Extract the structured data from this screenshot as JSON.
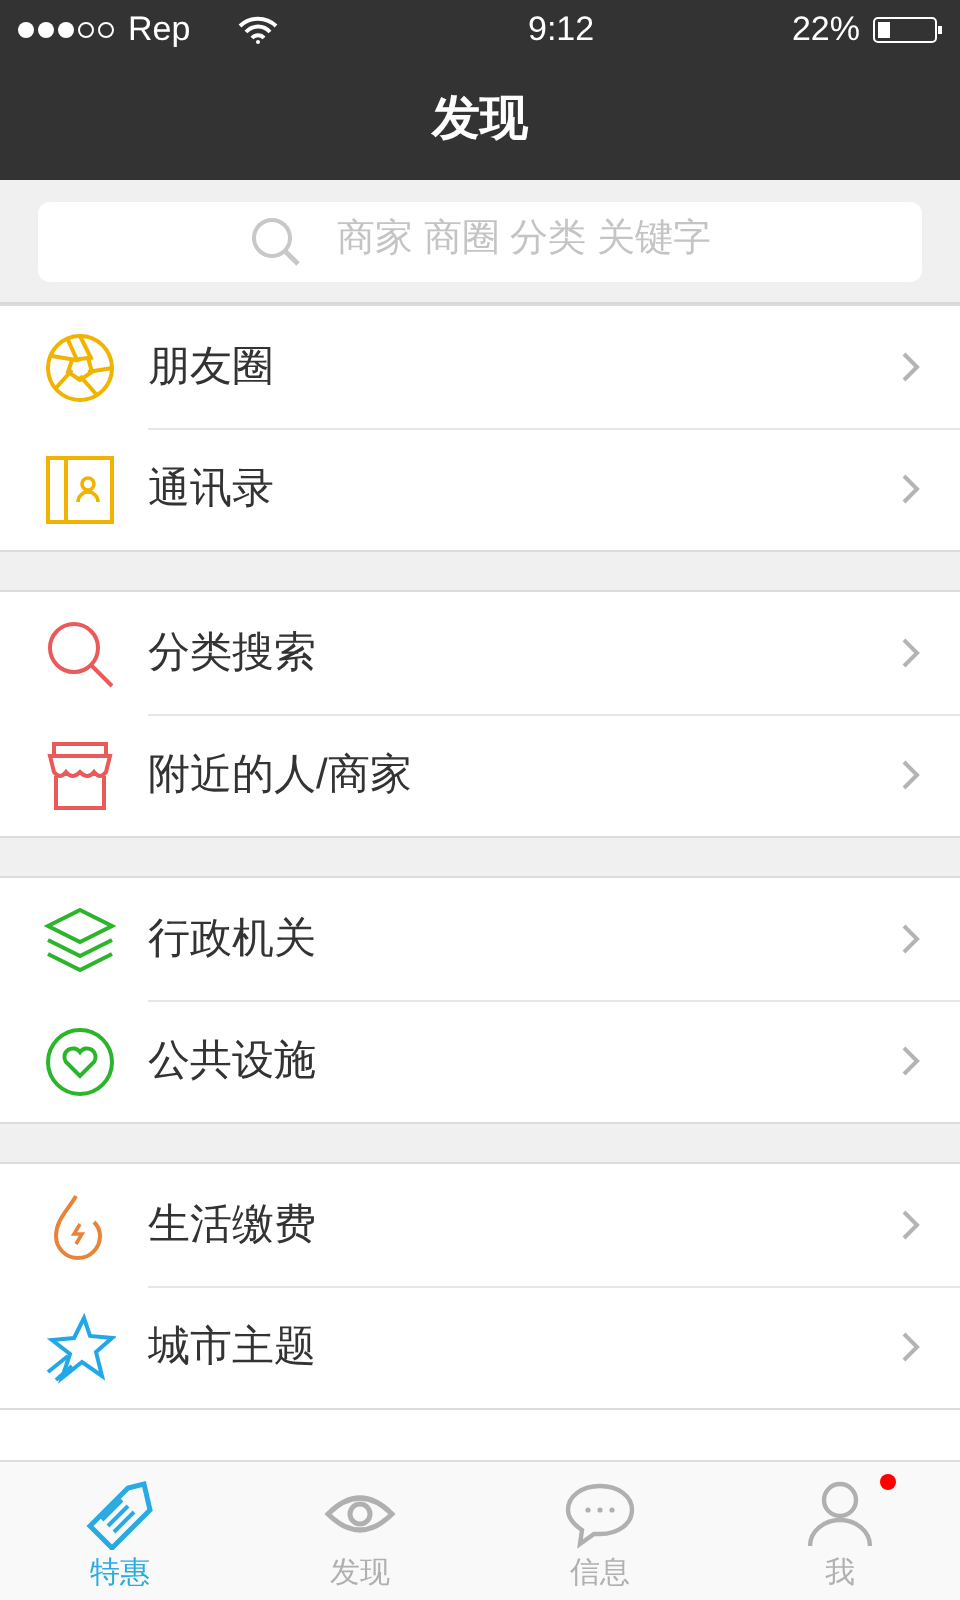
{
  "status_bar": {
    "carrier": "Rep",
    "time": "9:12",
    "battery": "22%"
  },
  "nav": {
    "title": "发现"
  },
  "search": {
    "placeholder": "商家 商圈 分类 关键字"
  },
  "groups": [
    {
      "items": [
        {
          "label": "朋友圈"
        },
        {
          "label": "通讯录"
        }
      ]
    },
    {
      "items": [
        {
          "label": "分类搜索"
        },
        {
          "label": "附近的人/商家"
        }
      ]
    },
    {
      "items": [
        {
          "label": "行政机关"
        },
        {
          "label": "公共设施"
        }
      ]
    },
    {
      "items": [
        {
          "label": "生活缴费"
        },
        {
          "label": "城市主题"
        }
      ]
    }
  ],
  "tab_bar": [
    {
      "label": "特惠",
      "selected": true,
      "badge": false
    },
    {
      "label": "发现",
      "selected": false,
      "badge": false
    },
    {
      "label": "信息",
      "selected": false,
      "badge": false
    },
    {
      "label": "我",
      "selected": false,
      "badge": true
    }
  ]
}
